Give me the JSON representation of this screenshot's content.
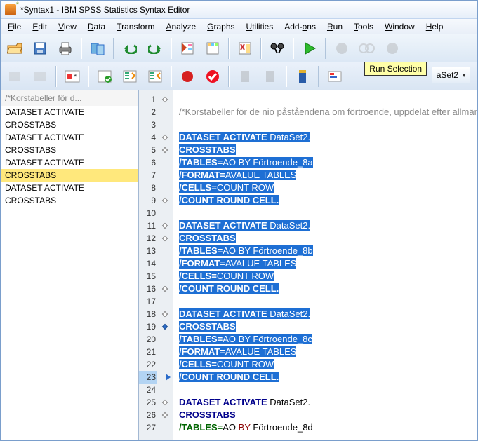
{
  "window": {
    "title": "*Syntax1 - IBM SPSS Statistics Syntax Editor"
  },
  "menus": [
    {
      "label": "File",
      "u": 0
    },
    {
      "label": "Edit",
      "u": 0
    },
    {
      "label": "View",
      "u": 0
    },
    {
      "label": "Data",
      "u": 0
    },
    {
      "label": "Transform",
      "u": 0
    },
    {
      "label": "Analyze",
      "u": 0
    },
    {
      "label": "Graphs",
      "u": 0
    },
    {
      "label": "Utilities",
      "u": 0
    },
    {
      "label": "Add-ons",
      "u": 4
    },
    {
      "label": "Run",
      "u": 0
    },
    {
      "label": "Tools",
      "u": 0
    },
    {
      "label": "Window",
      "u": 0
    },
    {
      "label": "Help",
      "u": 0
    }
  ],
  "tooltip": "Run Selection",
  "dataset_dropdown": "aSet2",
  "nav": {
    "header": "/*Korstabeller för d...",
    "items": [
      "DATASET ACTIVATE",
      "CROSSTABS",
      "DATASET ACTIVATE",
      "CROSSTABS",
      "DATASET ACTIVATE",
      "CROSSTABS",
      "DATASET ACTIVATE",
      "CROSSTABS"
    ],
    "selected_index": 5
  },
  "editor": {
    "current_line": 23,
    "lines": [
      {
        "n": 1,
        "marker": "open",
        "type": "blank"
      },
      {
        "n": 2,
        "type": "comment",
        "text": "/*Korstabeller för de nio påståendena om förtroende, uppdelat efter allmänna"
      },
      {
        "n": 3,
        "type": "blank"
      },
      {
        "n": 4,
        "marker": "open",
        "type": "sel",
        "parts": [
          {
            "c": "kw",
            "t": "DATASET ACTIVATE"
          },
          {
            "c": "arg",
            "t": " DataSet2."
          }
        ]
      },
      {
        "n": 5,
        "marker": "open",
        "type": "sel",
        "parts": [
          {
            "c": "kw",
            "t": "CROSSTABS"
          }
        ]
      },
      {
        "n": 6,
        "type": "sel",
        "parts": [
          {
            "c": "sub",
            "t": "  /TABLES="
          },
          {
            "c": "arg",
            "t": "AO BY Förtroende_8a"
          }
        ]
      },
      {
        "n": 7,
        "type": "sel",
        "parts": [
          {
            "c": "sub",
            "t": "  /FORMAT="
          },
          {
            "c": "arg",
            "t": "AVALUE TABLES"
          }
        ]
      },
      {
        "n": 8,
        "type": "sel",
        "parts": [
          {
            "c": "sub",
            "t": "  /CELLS="
          },
          {
            "c": "arg",
            "t": "COUNT ROW"
          }
        ]
      },
      {
        "n": 9,
        "marker": "open",
        "type": "sel",
        "parts": [
          {
            "c": "sub",
            "t": "  /COUNT ROUND CELL."
          }
        ]
      },
      {
        "n": 10,
        "type": "blank"
      },
      {
        "n": 11,
        "marker": "open",
        "type": "sel",
        "parts": [
          {
            "c": "kw",
            "t": "DATASET ACTIVATE"
          },
          {
            "c": "arg",
            "t": " DataSet2."
          }
        ]
      },
      {
        "n": 12,
        "marker": "open",
        "type": "sel",
        "parts": [
          {
            "c": "kw",
            "t": "CROSSTABS"
          }
        ]
      },
      {
        "n": 13,
        "type": "sel",
        "parts": [
          {
            "c": "sub",
            "t": "  /TABLES="
          },
          {
            "c": "arg",
            "t": "AO BY Förtroende_8b"
          }
        ]
      },
      {
        "n": 14,
        "type": "sel",
        "parts": [
          {
            "c": "sub",
            "t": "  /FORMAT="
          },
          {
            "c": "arg",
            "t": "AVALUE TABLES"
          }
        ]
      },
      {
        "n": 15,
        "type": "sel",
        "parts": [
          {
            "c": "sub",
            "t": "  /CELLS="
          },
          {
            "c": "arg",
            "t": "COUNT ROW"
          }
        ]
      },
      {
        "n": 16,
        "marker": "open",
        "type": "sel",
        "parts": [
          {
            "c": "sub",
            "t": "  /COUNT ROUND CELL."
          }
        ]
      },
      {
        "n": 17,
        "type": "blank"
      },
      {
        "n": 18,
        "marker": "open",
        "type": "sel",
        "parts": [
          {
            "c": "kw",
            "t": "DATASET ACTIVATE"
          },
          {
            "c": "arg",
            "t": " DataSet2."
          }
        ]
      },
      {
        "n": 19,
        "marker": "filled",
        "type": "sel",
        "parts": [
          {
            "c": "kw",
            "t": "CROSSTABS"
          }
        ]
      },
      {
        "n": 20,
        "type": "sel",
        "parts": [
          {
            "c": "sub",
            "t": "  /TABLES="
          },
          {
            "c": "arg",
            "t": "AO BY Förtroende_8c"
          }
        ]
      },
      {
        "n": 21,
        "type": "sel",
        "parts": [
          {
            "c": "sub",
            "t": "  /FORMAT="
          },
          {
            "c": "arg",
            "t": "AVALUE TABLES"
          }
        ]
      },
      {
        "n": 22,
        "type": "sel",
        "parts": [
          {
            "c": "sub",
            "t": "  /CELLS="
          },
          {
            "c": "arg",
            "t": "COUNT ROW"
          }
        ]
      },
      {
        "n": 23,
        "marker": "arrow",
        "type": "sel",
        "parts": [
          {
            "c": "sub",
            "t": "  /COUNT ROUND CELL."
          }
        ]
      },
      {
        "n": 24,
        "type": "blank"
      },
      {
        "n": 25,
        "marker": "open",
        "type": "plain",
        "parts": [
          {
            "c": "plain-kw",
            "t": "DATASET ACTIVATE"
          },
          {
            "c": "",
            "t": " DataSet2."
          }
        ]
      },
      {
        "n": 26,
        "marker": "open",
        "type": "plain",
        "parts": [
          {
            "c": "plain-kw",
            "t": "CROSSTABS"
          }
        ]
      },
      {
        "n": 27,
        "type": "plain",
        "parts": [
          {
            "c": "plain-sub",
            "t": "  /TABLES="
          },
          {
            "c": "",
            "t": "AO "
          },
          {
            "c": "plain-arg",
            "t": "BY"
          },
          {
            "c": "",
            "t": " Förtroende_8d"
          }
        ]
      }
    ]
  }
}
